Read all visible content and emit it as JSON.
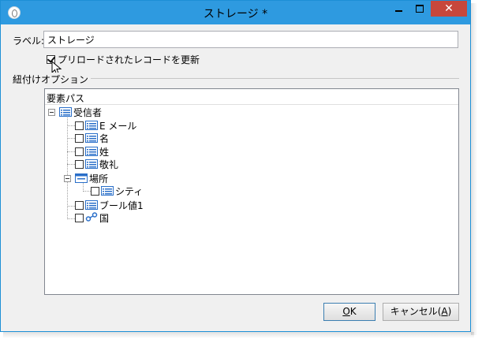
{
  "window": {
    "title": "ストレージ *",
    "close_glyph": "✕"
  },
  "label_field": {
    "label": "ラベル:",
    "value": "ストレージ"
  },
  "preload_checkbox": {
    "label": "プリロードされたレコードを更新",
    "checked": true
  },
  "linking_options": {
    "group_title": "紐付けオプション",
    "column_header": "要素パス",
    "tree": [
      {
        "label": "受信者",
        "icon": "list-icon",
        "expanded": true
      },
      {
        "label": "E メール",
        "icon": "list-icon",
        "checked": false
      },
      {
        "label": "名",
        "icon": "list-icon",
        "checked": false
      },
      {
        "label": "姓",
        "icon": "list-icon",
        "checked": false
      },
      {
        "label": "敬礼",
        "icon": "list-icon",
        "checked": false
      },
      {
        "label": "場所",
        "icon": "folder-list-icon",
        "expanded": true
      },
      {
        "label": "シティ",
        "icon": "list-icon",
        "checked": false
      },
      {
        "label": "ブール値1",
        "icon": "list-icon",
        "checked": false
      },
      {
        "label": "国",
        "icon": "link-icon",
        "checked": false
      }
    ]
  },
  "buttons": {
    "ok_label": "OK",
    "ok_mnemonic": "O",
    "ok_rest": "K",
    "cancel_label": "キャンセル(A)",
    "cancel_prefix": "キャンセル(",
    "cancel_mnemonic": "A",
    "cancel_suffix": ")"
  },
  "colors": {
    "titlebar": "#2e9ae0",
    "close_button": "#c7473c",
    "icon_blue": "#2a6fc9"
  }
}
